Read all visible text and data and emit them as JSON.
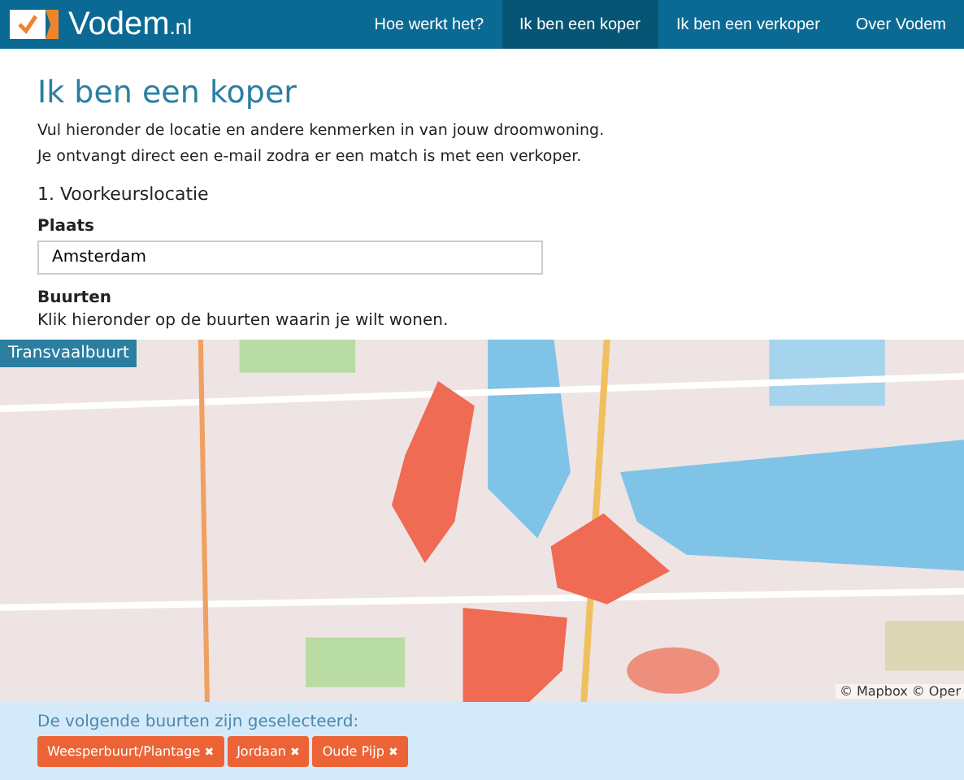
{
  "header": {
    "logo": "Vodem",
    "logo_suffix": ".nl",
    "nav": [
      {
        "label": "Hoe werkt het?",
        "selected": false
      },
      {
        "label": "Ik ben een koper",
        "selected": true
      },
      {
        "label": "Ik ben een verkoper",
        "selected": false
      },
      {
        "label": "Over Vodem",
        "selected": false
      }
    ]
  },
  "title": "Ik ben een koper",
  "intro": "Vul hieronder de locatie en andere kenmerken in van jouw droomwoning. Je ontvangt direct een e-mail zodra er een match is met een verkoper.",
  "section": "1. Voorkeurslocatie",
  "place": {
    "label": "Plaats",
    "value": "Amsterdam"
  },
  "neighbourhoods": {
    "label": "Buurten",
    "hint": "Klik hieronder op de buurten waarin je wilt wonen."
  },
  "map": {
    "kind": "picture",
    "hover_label": "Transvaalbuurt",
    "attribution": "© Mapbox © Oper"
  },
  "selection": {
    "label": "De volgende buurten zijn geselecteerd:",
    "tags": [
      {
        "label": "Weesperbuurt/Plantage",
        "remove": "✖"
      },
      {
        "label": "Jordaan",
        "remove": "✖"
      },
      {
        "label": "Oude Pijp",
        "remove": "✖"
      }
    ]
  }
}
